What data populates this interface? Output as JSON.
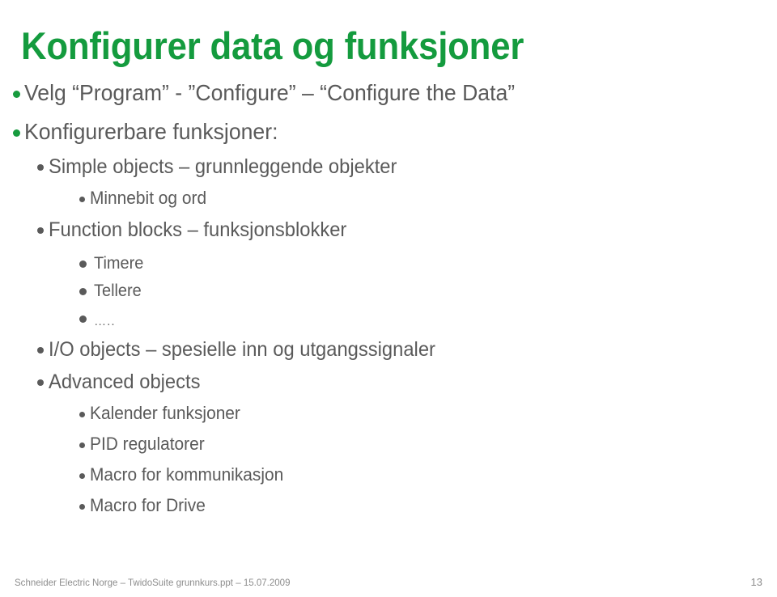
{
  "slide": {
    "title": "Konfigurer data og funksjoner",
    "title_color": "#149B3E",
    "body_color": "#5a5a5a",
    "bullet_green": "#179B3E",
    "background": "#ffffff"
  },
  "bullets": [
    {
      "level": 1,
      "text": "Velg “Program”  - ”Configure” – “Configure the Data”"
    },
    {
      "level": 1,
      "text": "Konfigurerbare funksjoner:"
    },
    {
      "level": 2,
      "text": "Simple objects – grunnleggende objekter"
    },
    {
      "level": 3,
      "text": "Minnebit og ord"
    },
    {
      "level": 2,
      "text": "Function blocks – funksjonsblokker"
    },
    {
      "level": 4,
      "text": "Timere"
    },
    {
      "level": 4,
      "text": "Tellere"
    },
    {
      "level": 4,
      "text": "….."
    },
    {
      "level": 2,
      "text": "I/O objects – spesielle inn og utgangssignaler"
    },
    {
      "level": 2,
      "text": "Advanced objects"
    },
    {
      "level": 3,
      "text": "Kalender funksjoner"
    },
    {
      "level": 3,
      "text": "PID regulatorer"
    },
    {
      "level": 3,
      "text": "Macro for kommunikasjon"
    },
    {
      "level": 3,
      "text": "Macro for Drive"
    }
  ],
  "footer": {
    "text": "Schneider Electric Norge – TwidoSuite grunnkurs.ppt – 15.07.2009",
    "page_number": "13",
    "color": "#8d8d8d"
  }
}
